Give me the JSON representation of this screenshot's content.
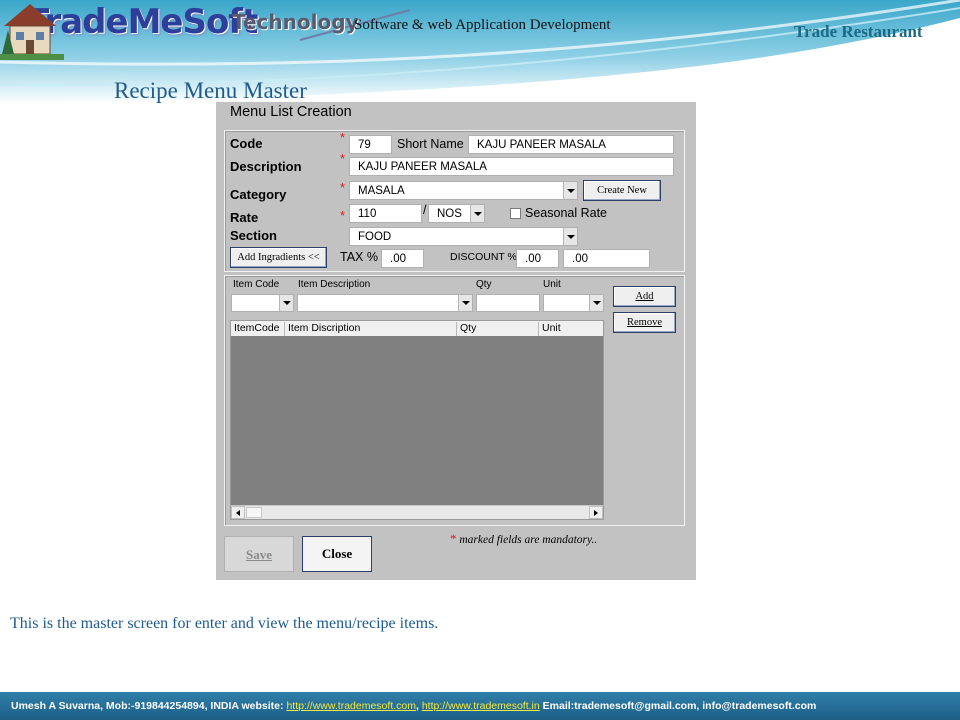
{
  "header": {
    "logo": "TradeMeSoft",
    "logo_sub": "Technology",
    "tagline": "Software & web Application Development",
    "brand_right": "Trade Restaurant"
  },
  "page_title": "Recipe Menu Master",
  "form": {
    "title": "Menu List Creation",
    "labels": {
      "code": "Code",
      "description": "Description",
      "category": "Category",
      "rate": "Rate",
      "section": "Section",
      "short_name": "Short Name",
      "seasonal_rate": "Seasonal Rate",
      "tax": "TAX %",
      "discount": "DISCOUNT %",
      "slash": "/"
    },
    "star": "*",
    "values": {
      "code": "79",
      "short_name": "KAJU PANEER MASALA",
      "description": "KAJU PANEER MASALA",
      "category": "MASALA",
      "rate": "110",
      "unit": "NOS",
      "section": "FOOD",
      "tax": ".00",
      "discount": ".00",
      "discount_amount": ".00"
    },
    "buttons": {
      "create_new": "Create New",
      "add_ingredients": "Add Ingradients <<",
      "add": "Add",
      "remove": "Remove",
      "save": "Save",
      "close": "Close"
    },
    "item_entry_headers": [
      "Item Code",
      "Item Description",
      "Qty",
      "Unit"
    ],
    "grid_columns": [
      "ItemCode",
      "Item Discription",
      "Qty",
      "Unit"
    ],
    "mandatory_note": "marked fields are mandatory.."
  },
  "caption": "This is the master screen for enter and view the menu/recipe items.",
  "footer": {
    "contact": "Umesh A Suvarna, Mob:-919844254894, INDIA   website: ",
    "link1": "http://www.trademesoft.com",
    "sep": ",   ",
    "link2": "http://www.trademesoft.in",
    "email": "   Email:trademesoft@gmail.com,  info@trademesoft.com"
  },
  "colors": {
    "title_blue": "#1e5b8e",
    "footer_bg": "#1d5f87",
    "link_yellow": "#f7ea3c",
    "star_red": "#d21f1f"
  }
}
